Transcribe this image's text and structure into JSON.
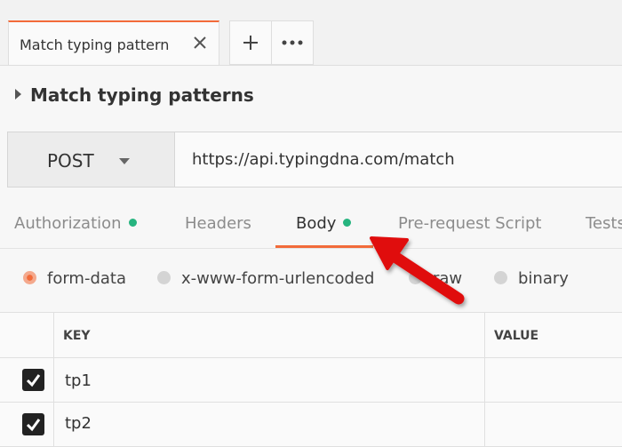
{
  "tabs": {
    "active_title": "Match typing pattern",
    "close_icon": "close-icon",
    "add_icon": "plus-icon",
    "more_icon": "more-horizontal-icon"
  },
  "request": {
    "name": "Match typing patterns",
    "method": "POST",
    "url": "https://api.typingdna.com/match"
  },
  "request_tabs": [
    {
      "label": "Authorization",
      "dot": true
    },
    {
      "label": "Headers",
      "dot": false
    },
    {
      "label": "Body",
      "dot": true,
      "active": true
    },
    {
      "label": "Pre-request Script",
      "dot": false
    },
    {
      "label": "Tests",
      "dot": false
    }
  ],
  "body_modes": [
    {
      "label": "form-data",
      "selected": true
    },
    {
      "label": "x-www-form-urlencoded",
      "selected": false
    },
    {
      "label": "raw",
      "selected": false
    },
    {
      "label": "binary",
      "selected": false
    }
  ],
  "table": {
    "headers": [
      "KEY",
      "VALUE"
    ],
    "rows": [
      {
        "checked": true,
        "key": "tp1",
        "value": ""
      },
      {
        "checked": true,
        "key": "tp2",
        "value": ""
      }
    ]
  },
  "colors": {
    "accent": "#f26b3a",
    "status_dot": "#26b47f",
    "annotation": "#e01010"
  }
}
